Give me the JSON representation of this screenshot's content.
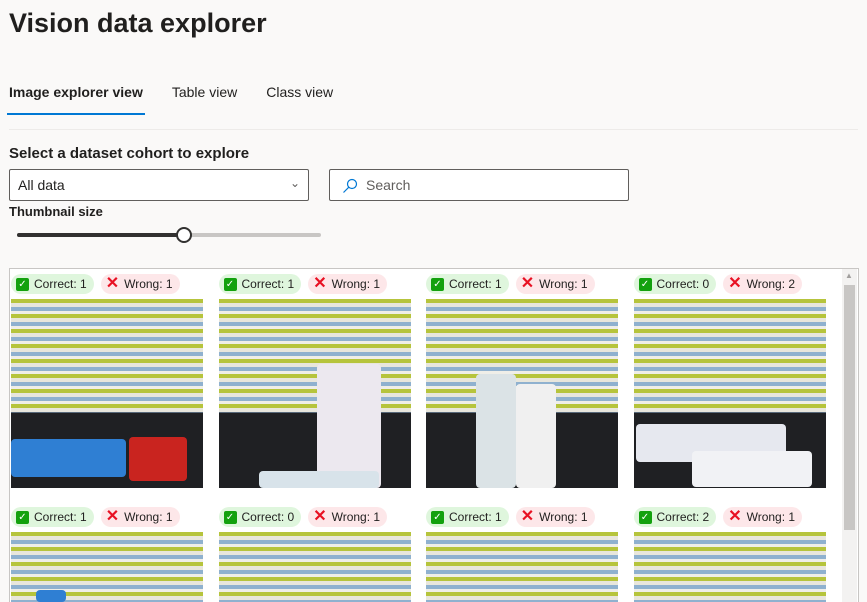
{
  "title": "Vision data explorer",
  "tabs": [
    {
      "label": "Image explorer view",
      "active": true
    },
    {
      "label": "Table view"
    },
    {
      "label": "Class view"
    }
  ],
  "cohort": {
    "label": "Select a dataset cohort to explore",
    "selected": "All data"
  },
  "search": {
    "placeholder": "Search"
  },
  "thumbnail": {
    "label": "Thumbnail size",
    "value_fraction": 0.55
  },
  "images": [
    {
      "correct": "Correct: 1",
      "wrong": "Wrong: 1"
    },
    {
      "correct": "Correct: 1",
      "wrong": "Wrong: 1"
    },
    {
      "correct": "Correct: 1",
      "wrong": "Wrong: 1"
    },
    {
      "correct": "Correct: 0",
      "wrong": "Wrong: 2"
    },
    {
      "correct": "Correct: 1",
      "wrong": "Wrong: 1"
    },
    {
      "correct": "Correct: 0",
      "wrong": "Wrong: 1"
    },
    {
      "correct": "Correct: 1",
      "wrong": "Wrong: 1"
    },
    {
      "correct": "Correct: 2",
      "wrong": "Wrong: 1"
    }
  ]
}
